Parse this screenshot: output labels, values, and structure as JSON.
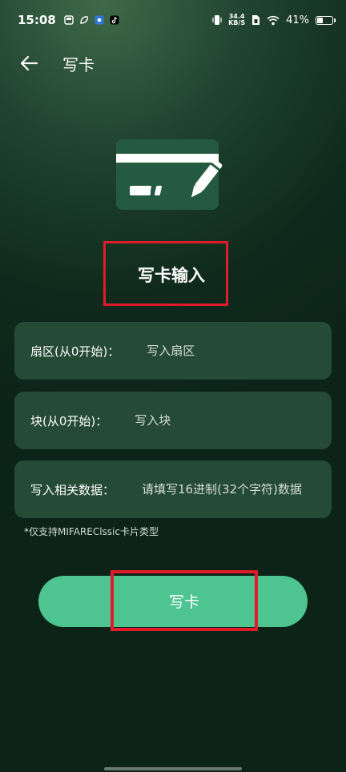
{
  "status_bar": {
    "time": "15:08",
    "net_speed_value": "34.4",
    "net_speed_unit": "KB/S",
    "battery_percent": "41%",
    "battery_level": 0.41
  },
  "header": {
    "title": "写卡"
  },
  "section": {
    "title": "写卡输入"
  },
  "fields": {
    "sector": {
      "label": "扇区(从0开始)：",
      "placeholder": "写入扇区"
    },
    "block": {
      "label": "块(从0开始)：",
      "placeholder": "写入块"
    },
    "data": {
      "label": "写入相关数据：",
      "placeholder": "请填写16进制(32个字符)数据"
    }
  },
  "note": "*仅支持MIFAREClssic卡片类型",
  "write_button": {
    "label": "写卡"
  },
  "colors": {
    "accent": "#4ec490",
    "field_bg": "#254a35",
    "highlight": "#e01c2a"
  }
}
